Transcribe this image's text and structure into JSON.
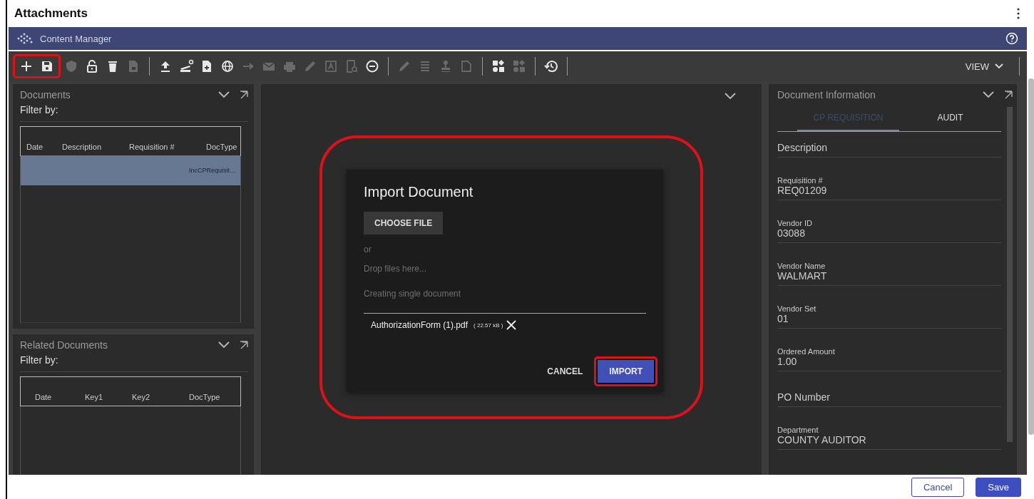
{
  "window": {
    "title": "Attachments"
  },
  "app_bar": {
    "title": "Content Manager"
  },
  "toolbar": {
    "highlighted_groups": [
      {
        "highlighted": true,
        "items": [
          {
            "kind": "plus",
            "disabled": false
          },
          {
            "kind": "save",
            "disabled": false
          }
        ]
      }
    ],
    "items": [
      {
        "kind": "shield",
        "disabled": true
      },
      {
        "kind": "unlock",
        "disabled": false
      },
      {
        "kind": "trash",
        "disabled": false
      },
      {
        "kind": "doclock",
        "disabled": true
      },
      {
        "kind": "divider"
      },
      {
        "kind": "upload",
        "disabled": false
      },
      {
        "kind": "scanner",
        "disabled": false
      },
      {
        "kind": "docplus",
        "disabled": false
      },
      {
        "kind": "globe",
        "disabled": false
      },
      {
        "kind": "arrow",
        "disabled": true
      },
      {
        "kind": "mail",
        "disabled": true
      },
      {
        "kind": "printer",
        "disabled": true
      },
      {
        "kind": "pencil",
        "disabled": true
      },
      {
        "kind": "imagetext",
        "disabled": true
      },
      {
        "kind": "docsearch",
        "disabled": true
      },
      {
        "kind": "minus",
        "disabled": false
      },
      {
        "kind": "divider"
      },
      {
        "kind": "pencil",
        "disabled": true
      },
      {
        "kind": "list",
        "disabled": true
      },
      {
        "kind": "stamp",
        "disabled": true
      },
      {
        "kind": "page",
        "disabled": true
      },
      {
        "kind": "divider"
      },
      {
        "kind": "shapes",
        "disabled": false
      },
      {
        "kind": "shapes",
        "disabled": true
      },
      {
        "kind": "divider"
      },
      {
        "kind": "history",
        "disabled": false
      },
      {
        "kind": "divider"
      }
    ],
    "view_button": "VIEW"
  },
  "documents": {
    "title": "Documents",
    "filter_label": "Filter by:",
    "columns": [
      "Date",
      "Description",
      "Requisition #",
      "DocType"
    ],
    "rows": [
      {
        "selected": true,
        "doc_type": "IncCPRequisit…"
      }
    ]
  },
  "related_documents": {
    "title": "Related Documents",
    "filter_label": "Filter by:",
    "columns": [
      "Date",
      "Key1",
      "Key2",
      "DocType"
    ]
  },
  "dialog": {
    "title": "Import Document",
    "highlighted": true,
    "choose_button": "CHOOSE FILE",
    "or_text": "or",
    "drop_hint": "Drop files here...",
    "mode_text": "Creating single document",
    "files": [
      {
        "name": "AuthorizationForm (1).pdf",
        "size": "( 22.57 kB )"
      }
    ],
    "buttons": [
      {
        "label": "CANCEL",
        "kind": "text",
        "highlighted": false
      },
      {
        "label": "IMPORT",
        "kind": "primary",
        "highlighted": true
      }
    ]
  },
  "document_information": {
    "title": "Document Information",
    "tabs": [
      {
        "label": "CP REQUISITION",
        "selected": true
      },
      {
        "label": "AUDIT",
        "selected": false
      }
    ],
    "fields": [
      {
        "kind": "heading",
        "label": "Description"
      },
      {
        "kind": "field",
        "label": "Requisition #",
        "value": "REQ01209"
      },
      {
        "kind": "field",
        "label": "Vendor ID",
        "value": "03088"
      },
      {
        "kind": "field",
        "label": "Vendor Name",
        "value": "WALMART"
      },
      {
        "kind": "field",
        "label": "Vendor Set",
        "value": "01"
      },
      {
        "kind": "field",
        "label": "Ordered Amount",
        "value": "1.00"
      },
      {
        "kind": "heading",
        "label": "PO Number"
      },
      {
        "kind": "field",
        "label": "Department",
        "value": "COUNTY AUDITOR"
      }
    ]
  },
  "footer_buttons": [
    {
      "label": "Cancel",
      "kind": "secondary"
    },
    {
      "label": "Save",
      "kind": "primary"
    }
  ]
}
